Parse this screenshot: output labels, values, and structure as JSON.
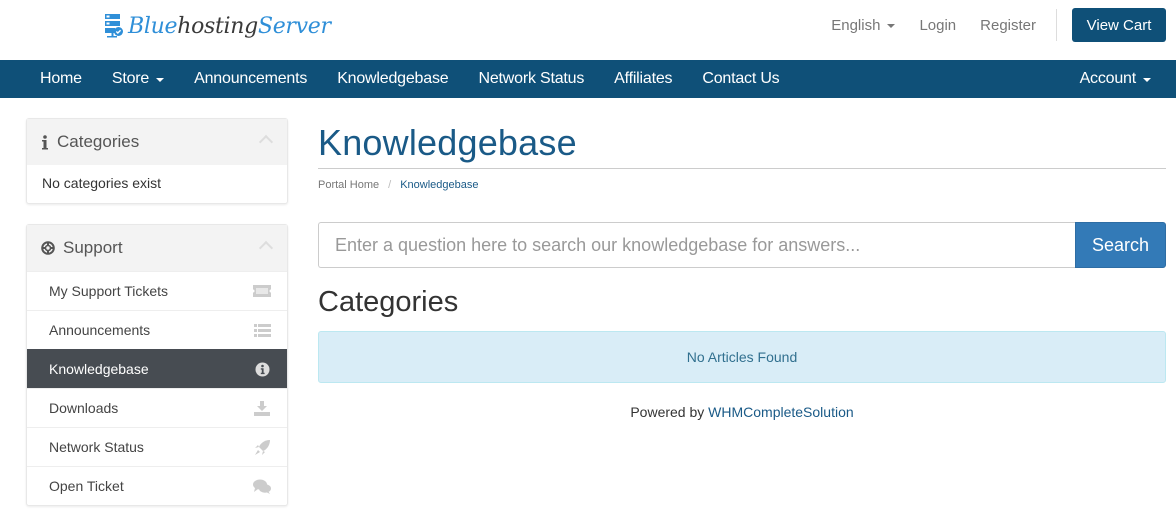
{
  "brand": {
    "name_part1": "Blue",
    "name_part2": "hosting",
    "name_part3": "Server",
    "primary_color": "#0f5078",
    "accent_color": "#2f8fd8",
    "logo_icon": "server-check-icon"
  },
  "top_links": {
    "language": "English",
    "login": "Login",
    "register": "Register",
    "view_cart": "View Cart"
  },
  "nav": {
    "items": [
      {
        "label": "Home",
        "dropdown": false
      },
      {
        "label": "Store",
        "dropdown": true
      },
      {
        "label": "Announcements",
        "dropdown": false
      },
      {
        "label": "Knowledgebase",
        "dropdown": false
      },
      {
        "label": "Network Status",
        "dropdown": false
      },
      {
        "label": "Affiliates",
        "dropdown": false
      },
      {
        "label": "Contact Us",
        "dropdown": false
      }
    ],
    "account": "Account"
  },
  "sidebar": {
    "categories_panel": {
      "title": "Categories",
      "icon": "info-icon",
      "empty_text": "No categories exist"
    },
    "support_panel": {
      "title": "Support",
      "icon": "life-ring-icon",
      "items": [
        {
          "label": "My Support Tickets",
          "icon": "ticket-icon",
          "active": false
        },
        {
          "label": "Announcements",
          "icon": "list-icon",
          "active": false
        },
        {
          "label": "Knowledgebase",
          "icon": "info-circle-icon",
          "active": true
        },
        {
          "label": "Downloads",
          "icon": "download-icon",
          "active": false
        },
        {
          "label": "Network Status",
          "icon": "rocket-icon",
          "active": false
        },
        {
          "label": "Open Ticket",
          "icon": "comments-icon",
          "active": false
        }
      ]
    }
  },
  "main": {
    "title": "Knowledgebase",
    "breadcrumb": [
      {
        "label": "Portal Home"
      },
      {
        "label": "Knowledgebase"
      }
    ],
    "search": {
      "placeholder": "Enter a question here to search our knowledgebase for answers...",
      "value": "",
      "button": "Search"
    },
    "section_title": "Categories",
    "alert_text": "No Articles Found",
    "powered_by_prefix": "Powered by",
    "powered_by_link": "WHMCompleteSolution"
  }
}
